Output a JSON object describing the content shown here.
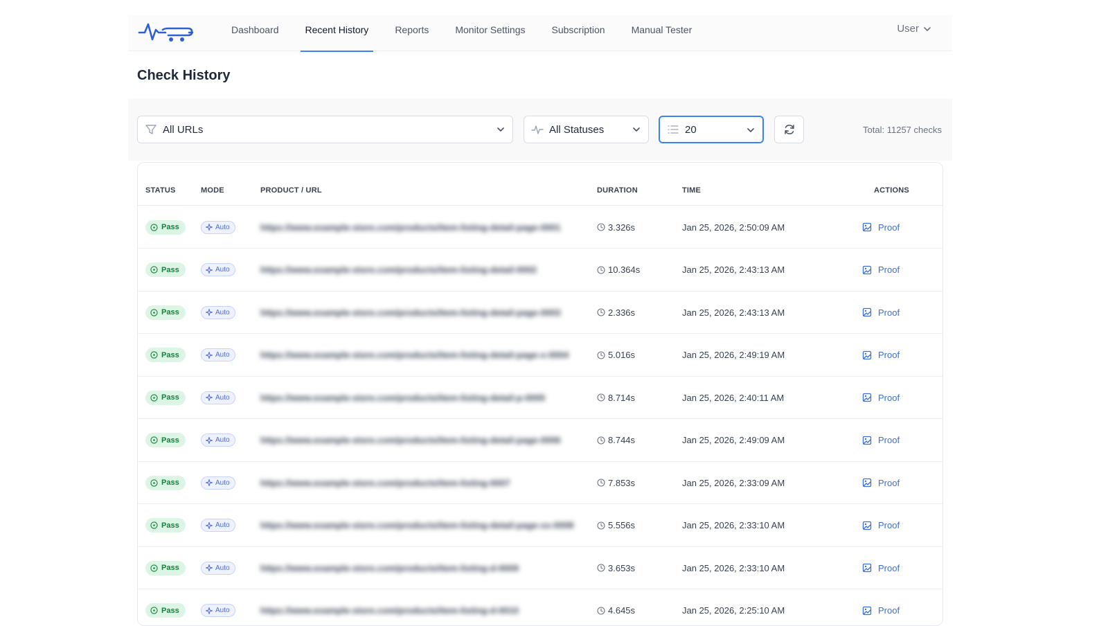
{
  "nav": {
    "items": [
      {
        "label": "Dashboard",
        "name": "nav-dashboard",
        "active": false
      },
      {
        "label": "Recent History",
        "name": "nav-recent-history",
        "active": true
      },
      {
        "label": "Reports",
        "name": "nav-reports",
        "active": false
      },
      {
        "label": "Monitor Settings",
        "name": "nav-monitor-settings",
        "active": false
      },
      {
        "label": "Subscription",
        "name": "nav-subscription",
        "active": false
      },
      {
        "label": "Manual Tester",
        "name": "nav-manual-tester",
        "active": false
      }
    ],
    "user_label": "User"
  },
  "page": {
    "title": "Check History"
  },
  "filters": {
    "url_filter": "All URLs",
    "status_filter": "All Statuses",
    "page_size": "20",
    "total": "Total: 11257 checks"
  },
  "table": {
    "headers": {
      "status": "STATUS",
      "mode": "MODE",
      "product": "PRODUCT / URL",
      "duration": "DURATION",
      "time": "TIME",
      "actions": "ACTIONS"
    },
    "rows": [
      {
        "status": "Pass",
        "mode": "Auto",
        "url": "https://www.example-store.com/products/item-listing-detail-page-0001",
        "duration": "3.326s",
        "time": "Jan 25, 2026, 2:50:09 AM",
        "action": "Proof"
      },
      {
        "status": "Pass",
        "mode": "Auto",
        "url": "https://www.example-store.com/products/item-listing-detail-0002",
        "duration": "10.364s",
        "time": "Jan 25, 2026, 2:43:13 AM",
        "action": "Proof"
      },
      {
        "status": "Pass",
        "mode": "Auto",
        "url": "https://www.example-store.com/products/item-listing-detail-page-0003",
        "duration": "2.336s",
        "time": "Jan 25, 2026, 2:43:13 AM",
        "action": "Proof"
      },
      {
        "status": "Pass",
        "mode": "Auto",
        "url": "https://www.example-store.com/products/item-listing-detail-page-x-0004",
        "duration": "5.016s",
        "time": "Jan 25, 2026, 2:49:19 AM",
        "action": "Proof"
      },
      {
        "status": "Pass",
        "mode": "Auto",
        "url": "https://www.example-store.com/products/item-listing-detail-p-0005",
        "duration": "8.714s",
        "time": "Jan 25, 2026, 2:40:11 AM",
        "action": "Proof"
      },
      {
        "status": "Pass",
        "mode": "Auto",
        "url": "https://www.example-store.com/products/item-listing-detail-page-0006",
        "duration": "8.744s",
        "time": "Jan 25, 2026, 2:49:09 AM",
        "action": "Proof"
      },
      {
        "status": "Pass",
        "mode": "Auto",
        "url": "https://www.example-store.com/products/item-listing-0007",
        "duration": "7.853s",
        "time": "Jan 25, 2026, 2:33:09 AM",
        "action": "Proof"
      },
      {
        "status": "Pass",
        "mode": "Auto",
        "url": "https://www.example-store.com/products/item-listing-detail-page-xx-0008",
        "duration": "5.556s",
        "time": "Jan 25, 2026, 2:33:10 AM",
        "action": "Proof"
      },
      {
        "status": "Pass",
        "mode": "Auto",
        "url": "https://www.example-store.com/products/item-listing-d-0009",
        "duration": "3.653s",
        "time": "Jan 25, 2026, 2:33:10 AM",
        "action": "Proof"
      },
      {
        "status": "Pass",
        "mode": "Auto",
        "url": "https://www.example-store.com/products/item-listing-d-0010",
        "duration": "4.645s",
        "time": "Jan 25, 2026, 2:25:10 AM",
        "action": "Proof"
      }
    ]
  },
  "colors": {
    "accent": "#3b82f6",
    "pass_bg": "#dcf5e4",
    "pass_text": "#15803d",
    "auto_text": "#4f6bd8",
    "link": "#3b6fd6"
  }
}
